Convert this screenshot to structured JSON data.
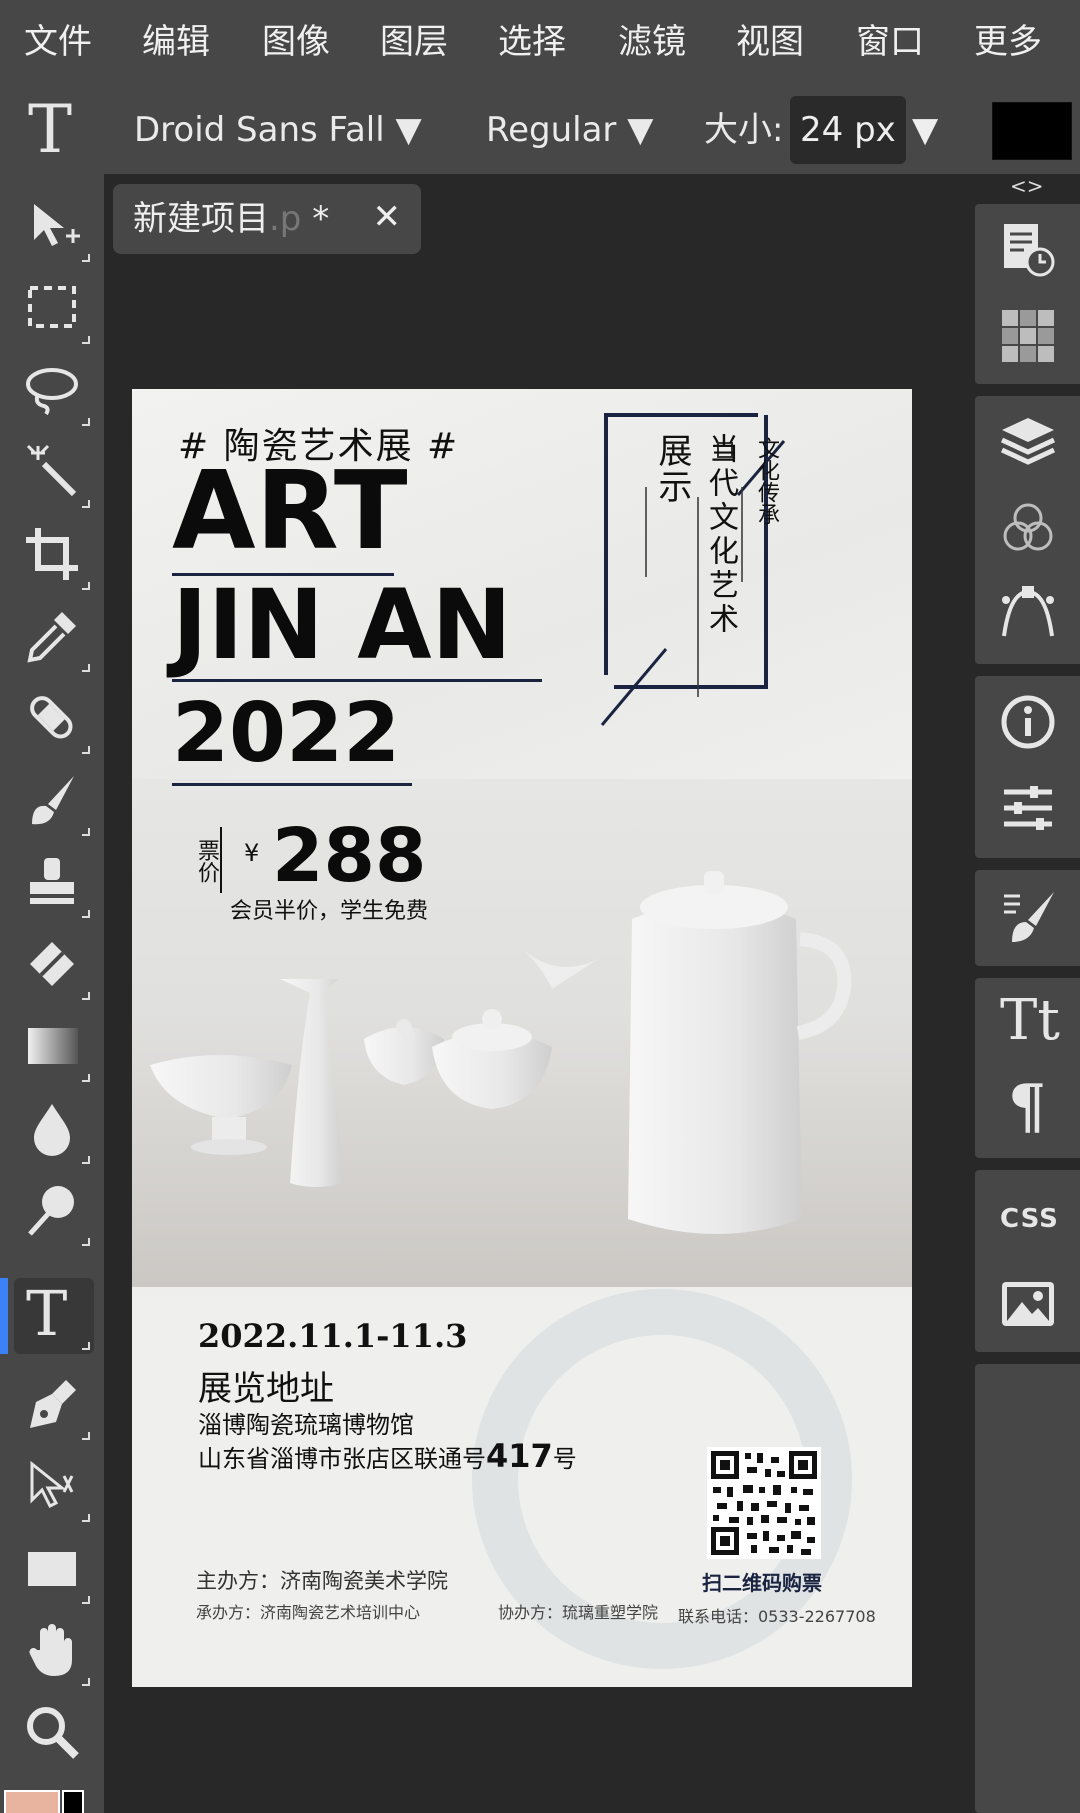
{
  "menu": [
    "文件",
    "编辑",
    "图像",
    "图层",
    "选择",
    "滤镜",
    "视图",
    "窗口",
    "更多"
  ],
  "options": {
    "font_family": "Droid Sans Fall ▼",
    "font_style": "Regular ▼",
    "size_label": "大小:",
    "size_value": "24 px",
    "size_arrow": "▼",
    "color": "#000000"
  },
  "doc_tab": {
    "name": "新建项目",
    "ext": ".p",
    "modified": "*",
    "close": "✕"
  },
  "right_panel": {
    "collapse": "<>",
    "css_label": "CSS"
  },
  "poster": {
    "hashtag": "# 陶瓷艺术展 #",
    "line1": "ART",
    "line2": "JIN AN",
    "line3": "2022",
    "vert_1": "展示",
    "vert_2": "当代文化艺术",
    "vert_3": "文化传承",
    "price_label": "票价",
    "yen": "¥",
    "price": "288",
    "price_note": "会员半价，学生免费",
    "date": "2022.11.1-11.3",
    "venue_title": "展览地址",
    "venue_name": "淄博陶瓷琉璃博物馆",
    "address_prefix": "山东省淄博市张店区联通号",
    "address_num": "417",
    "address_suffix": "号",
    "qr_caption": "扫二维码购票",
    "host": "主办方：济南陶瓷美术学院",
    "undertaker": "承办方：济南陶瓷艺术培训中心",
    "co_host": "协办方：琉璃重塑学院",
    "phone": "联系电话：0533-2267708"
  }
}
